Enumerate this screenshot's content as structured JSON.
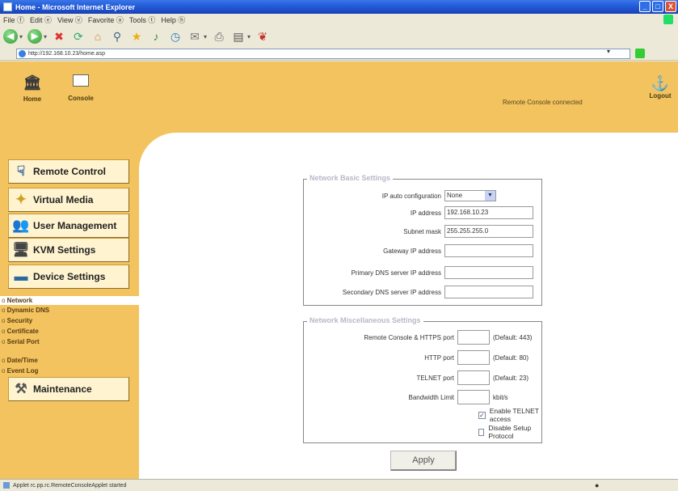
{
  "window": {
    "title": "Home - Microsoft Internet Explorer",
    "buttons": [
      "_",
      "□",
      "X"
    ]
  },
  "menu": {
    "items": [
      "File ⓕ",
      "Edit ⓔ",
      "View ⓥ",
      "Favorite ⓐ",
      "Tools ⓣ",
      "Help ⓗ"
    ]
  },
  "address": {
    "url": "http://192.168.10.23/home.asp"
  },
  "header": {
    "home_label": "Home",
    "console_label": "Console",
    "status": "Remote Console connected",
    "logout_label": "Logout"
  },
  "sidebar": {
    "nav": [
      {
        "label": "Remote Control",
        "icon": "remote-control-icon"
      },
      {
        "label": "Virtual Media",
        "icon": "virtual-media-icon"
      },
      {
        "label": "User Management",
        "icon": "user-management-icon"
      },
      {
        "label": "KVM Settings",
        "icon": "kvm-settings-icon"
      },
      {
        "label": "Device Settings",
        "icon": "device-settings-icon"
      },
      {
        "label": "Maintenance",
        "icon": "maintenance-icon"
      }
    ],
    "device_sub": [
      "Network",
      "Dynamic DNS",
      "Security",
      "Certificate",
      "Serial Port"
    ],
    "device_sub2": [
      "Date/Time",
      "Event Log"
    ],
    "active": "Network"
  },
  "basic": {
    "legend": "Network Basic Settings",
    "ip_auto_label": "IP auto configuration",
    "ip_auto_value": "None",
    "ip_label": "IP address",
    "ip_value": "192.168.10.23",
    "subnet_label": "Subnet mask",
    "subnet_value": "255.255.255.0",
    "gateway_label": "Gateway IP address",
    "gateway_value": "",
    "dns1_label": "Primary DNS server IP address",
    "dns1_value": "",
    "dns2_label": "Secondary DNS server IP address",
    "dns2_value": ""
  },
  "misc": {
    "legend": "Network Miscellaneous Settings",
    "https_label": "Remote Console & HTTPS port",
    "https_value": "",
    "https_note": "(Default: 443)",
    "http_label": "HTTP port",
    "http_value": "",
    "http_note": "(Default: 80)",
    "telnet_label": "TELNET port",
    "telnet_value": "",
    "telnet_note": "(Default: 23)",
    "bw_label": "Bandwidth Limit",
    "bw_value": "",
    "bw_unit": "kbit/s",
    "enable_telnet": "Enable TELNET access",
    "enable_telnet_checked": true,
    "disable_setup": "Disable Setup Protocol",
    "disable_setup_checked": false
  },
  "apply_label": "Apply",
  "statusbar": {
    "text": "Applet rc.pp.rc.RemoteConsoleApplet started"
  },
  "colors": {
    "sidebar_bg": "#f2c35e",
    "content_bg": "#ffffff",
    "titlebar": "#245edb"
  }
}
